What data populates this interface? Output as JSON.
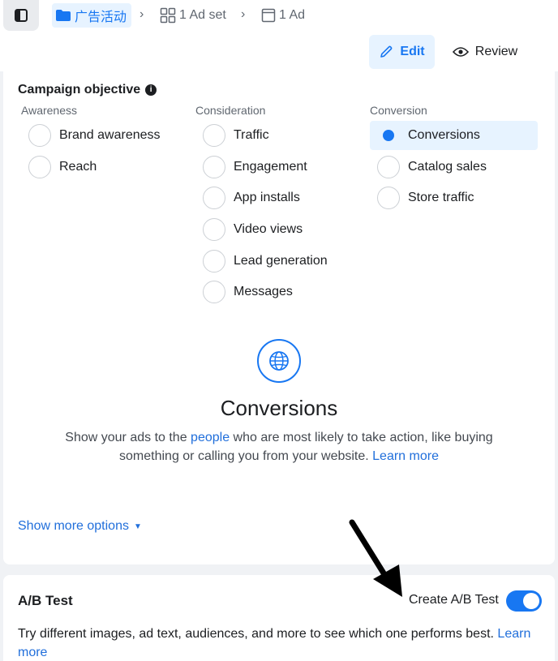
{
  "breadcrumb": {
    "campaign_label": "广告活动",
    "adset_label": "1 Ad set",
    "ad_label": "1 Ad"
  },
  "header": {
    "edit_label": "Edit",
    "review_label": "Review"
  },
  "objective": {
    "title": "Campaign objective",
    "columns": [
      {
        "heading": "Awareness",
        "options": [
          "Brand awareness",
          "Reach"
        ]
      },
      {
        "heading": "Consideration",
        "options": [
          "Traffic",
          "Engagement",
          "App installs",
          "Video views",
          "Lead generation",
          "Messages"
        ]
      },
      {
        "heading": "Conversion",
        "options": [
          "Conversions",
          "Catalog sales",
          "Store traffic"
        ]
      }
    ],
    "selected": "Conversions",
    "detail": {
      "title": "Conversions",
      "desc_before": "Show your ads to the ",
      "desc_link": "people",
      "desc_after": " who are most likely to take action, like buying something or calling you from your website. ",
      "learn_more": "Learn more"
    },
    "show_more": "Show more options"
  },
  "ab_test": {
    "title": "A/B Test",
    "toggle_label": "Create A/B Test",
    "toggle_on": true,
    "description": "Try different images, ad text, audiences, and more to see which one performs best. ",
    "learn_more": "Learn more"
  },
  "colors": {
    "accent": "#1877f2",
    "link": "#216fdb",
    "selected_bg": "#e7f3ff"
  },
  "icons": [
    "sidebar-toggle-icon",
    "folder-icon",
    "grid-icon",
    "ad-icon",
    "pencil-icon",
    "eye-icon",
    "info-icon",
    "globe-icon",
    "caret-down-icon"
  ]
}
